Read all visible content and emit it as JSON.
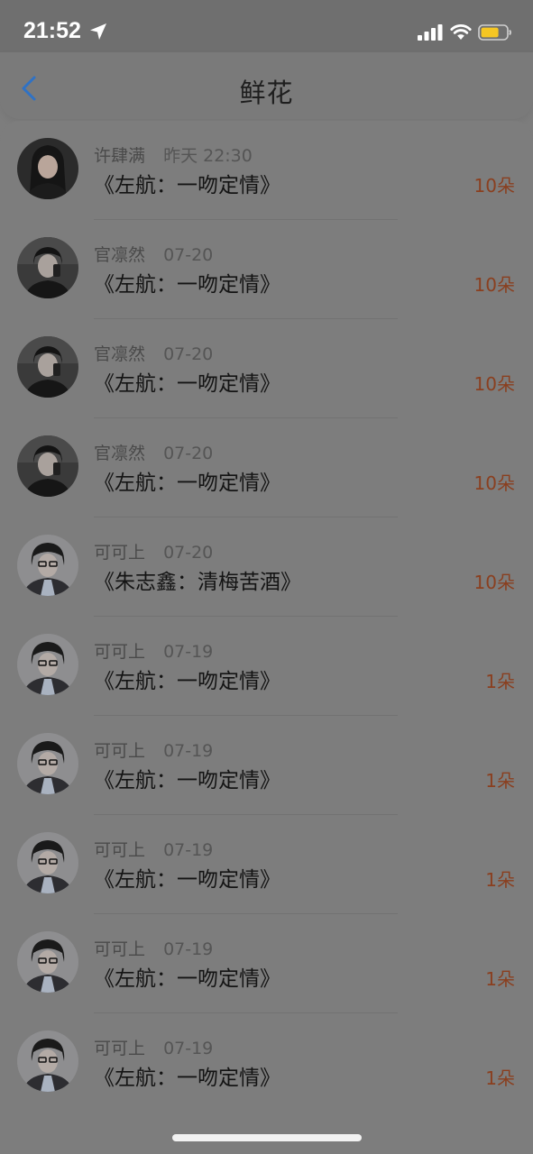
{
  "status_bar": {
    "time": "21:52",
    "icons": [
      "location-arrow-icon",
      "signal-icon",
      "wifi-icon",
      "battery-icon"
    ],
    "battery_color": "#f5c623"
  },
  "nav": {
    "title": "鲜花",
    "back_icon": "chevron-left-icon",
    "back_color": "#2f72c5"
  },
  "colors": {
    "amount": "#8a3f1f",
    "background": "#7d7d7d"
  },
  "records": [
    {
      "user": "许肆满",
      "time": "昨天 22:30",
      "work": "《左航：一吻定情》",
      "amount": "10朵",
      "avatar": "user-avatar-1"
    },
    {
      "user": "官凛然",
      "time": "07-20",
      "work": "《左航：一吻定情》",
      "amount": "10朵",
      "avatar": "user-avatar-2"
    },
    {
      "user": "官凛然",
      "time": "07-20",
      "work": "《左航：一吻定情》",
      "amount": "10朵",
      "avatar": "user-avatar-2"
    },
    {
      "user": "官凛然",
      "time": "07-20",
      "work": "《左航：一吻定情》",
      "amount": "10朵",
      "avatar": "user-avatar-2"
    },
    {
      "user": "可可上",
      "time": "07-20",
      "work": "《朱志鑫：清梅苦酒》",
      "amount": "10朵",
      "avatar": "user-avatar-3"
    },
    {
      "user": "可可上",
      "time": "07-19",
      "work": "《左航：一吻定情》",
      "amount": "1朵",
      "avatar": "user-avatar-3"
    },
    {
      "user": "可可上",
      "time": "07-19",
      "work": "《左航：一吻定情》",
      "amount": "1朵",
      "avatar": "user-avatar-3"
    },
    {
      "user": "可可上",
      "time": "07-19",
      "work": "《左航：一吻定情》",
      "amount": "1朵",
      "avatar": "user-avatar-3"
    },
    {
      "user": "可可上",
      "time": "07-19",
      "work": "《左航：一吻定情》",
      "amount": "1朵",
      "avatar": "user-avatar-3"
    },
    {
      "user": "可可上",
      "time": "07-19",
      "work": "《左航：一吻定情》",
      "amount": "1朵",
      "avatar": "user-avatar-3"
    }
  ]
}
